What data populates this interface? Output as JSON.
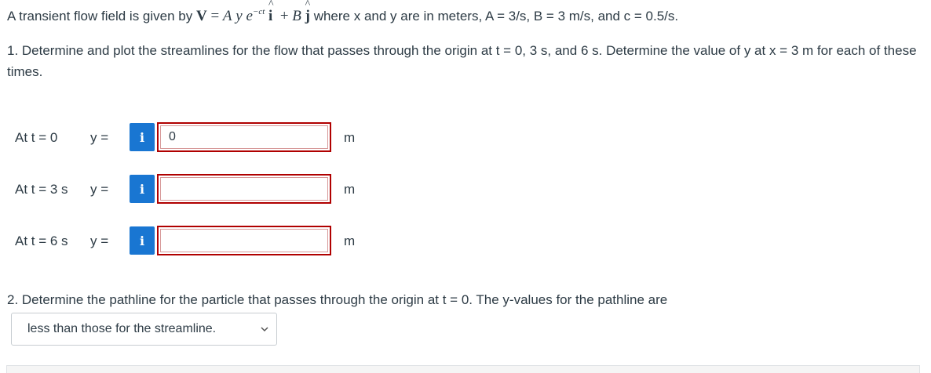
{
  "intro": {
    "prefix": "A transient flow field is given by ",
    "suffix": " where x and y are in meters, A = 3/s, B = 3 m/s, and c = 0.5/s."
  },
  "question1": {
    "text": "1. Determine and plot the streamlines for the flow that passes through the origin at t = 0, 3 s, and 6 s. Determine the value of y at x = 3 m for each of these times."
  },
  "rows": [
    {
      "label": "At t = 0",
      "y_label": "y =",
      "value": "0",
      "unit": "m",
      "info": "i"
    },
    {
      "label": "At t = 3 s",
      "y_label": "y =",
      "value": "",
      "unit": "m",
      "info": "i"
    },
    {
      "label": "At t = 6 s",
      "y_label": "y =",
      "value": "",
      "unit": "m",
      "info": "i"
    }
  ],
  "question2": {
    "text": "2. Determine the pathline for the particle that passes through the origin at t = 0. The y-values for the pathline are",
    "selected": "less than those for the streamline."
  },
  "colors": {
    "info_button": "#1976d2",
    "answer_border": "#b00000",
    "text": "#2d3b45"
  }
}
